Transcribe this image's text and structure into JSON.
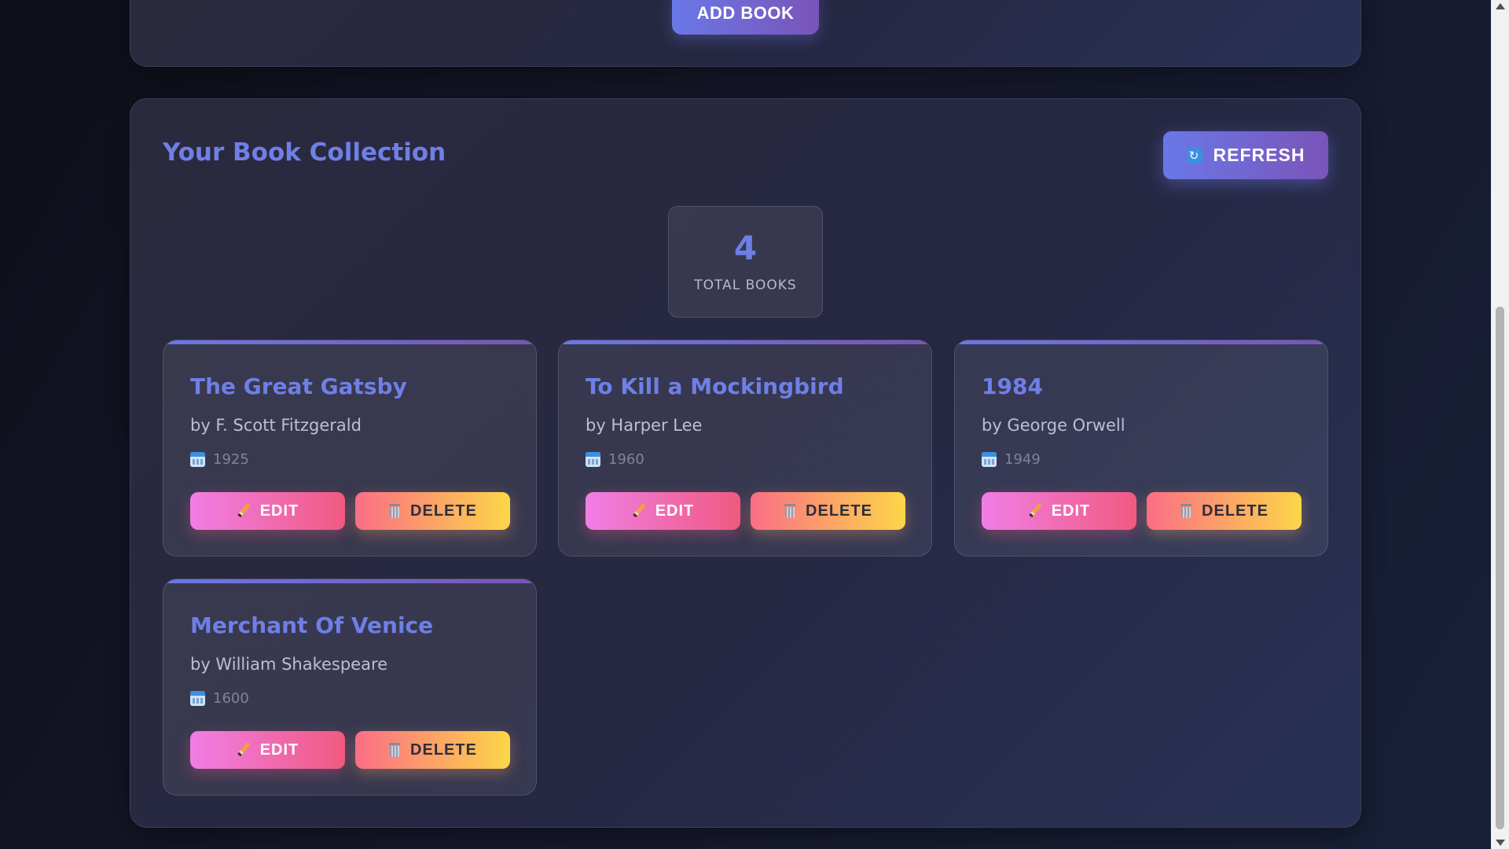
{
  "form": {
    "add_button_label": "ADD BOOK"
  },
  "collection": {
    "title": "Your Book Collection",
    "refresh_label": "REFRESH",
    "refresh_icon": "refresh-icon",
    "stat": {
      "count": "4",
      "label": "TOTAL BOOKS"
    }
  },
  "books": [
    {
      "title": "The Great Gatsby",
      "author": "by F. Scott Fitzgerald",
      "year": "1925"
    },
    {
      "title": "To Kill a Mockingbird",
      "author": "by Harper Lee",
      "year": "1960"
    },
    {
      "title": "1984",
      "author": "by George Orwell",
      "year": "1949"
    },
    {
      "title": "Merchant Of Venice",
      "author": "by William Shakespeare",
      "year": "1600"
    }
  ],
  "actions": {
    "edit_label": "EDIT",
    "delete_label": "DELETE"
  },
  "colors": {
    "accent": "#6f7fe6",
    "button_gradient_start": "#6a78e8",
    "button_gradient_end": "#7a54b8",
    "edit_gradient_start": "#f07ee6",
    "edit_gradient_end": "#f05a80",
    "delete_gradient_start": "#fb6e86",
    "delete_gradient_end": "#fcd648"
  }
}
